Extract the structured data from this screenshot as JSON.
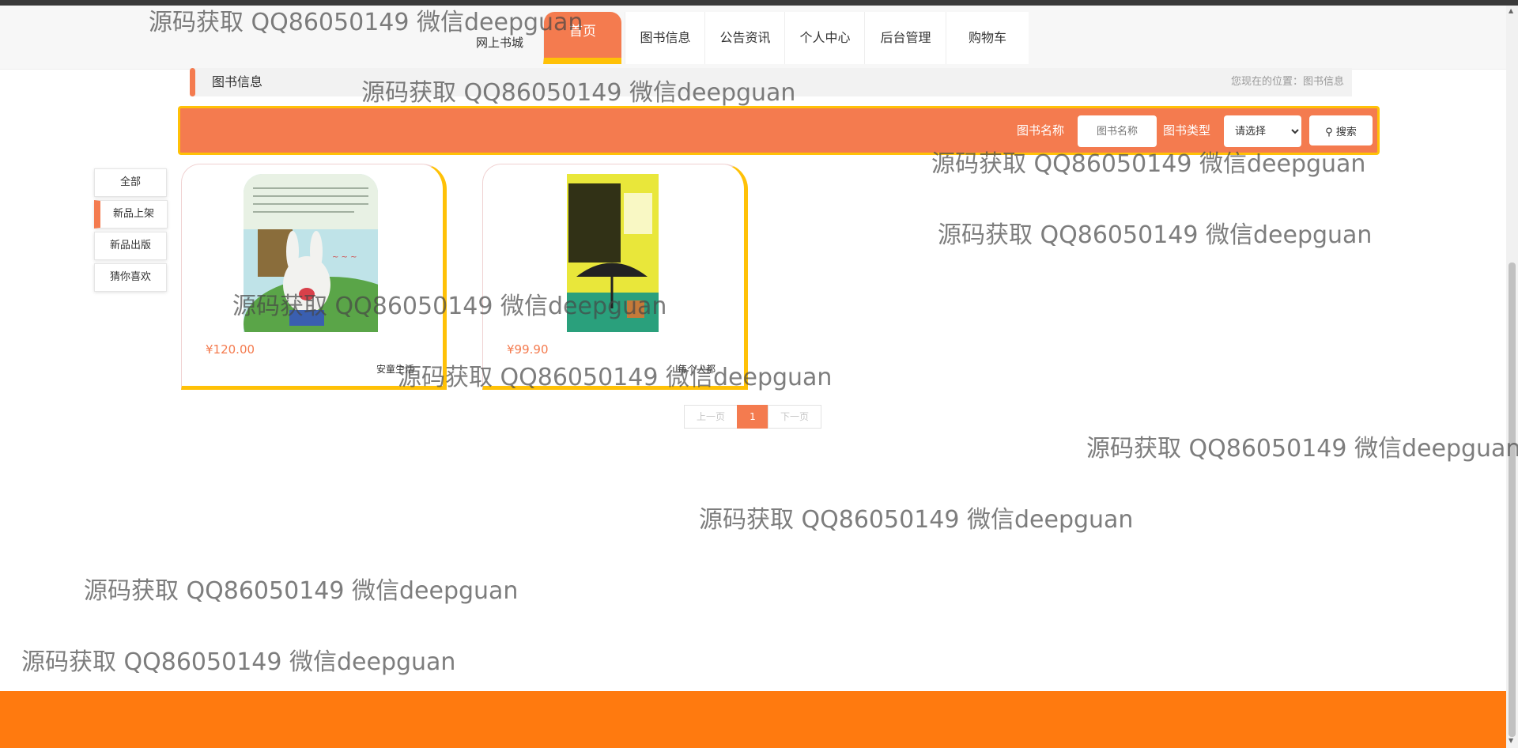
{
  "navbar": {
    "brand": "网上书城",
    "items": [
      {
        "label": "首页"
      },
      {
        "label": "图书信息"
      },
      {
        "label": "公告资讯"
      },
      {
        "label": "个人中心"
      },
      {
        "label": "后台管理"
      },
      {
        "label": "购物车"
      }
    ]
  },
  "section": {
    "title": "图书信息",
    "breadcrumb": "您现在的位置：图书信息"
  },
  "search": {
    "name_label": "图书名称",
    "name_placeholder": "图书名称",
    "type_label": "图书类型",
    "type_selected": "请选择",
    "button_label": "搜索"
  },
  "side_menu": {
    "items": [
      {
        "label": "全部"
      },
      {
        "label": "新品上架"
      },
      {
        "label": "新品出版"
      },
      {
        "label": "猜你喜欢"
      }
    ]
  },
  "books": [
    {
      "price": "¥120.00",
      "name": "安童生活"
    },
    {
      "price": "¥99.90",
      "name": "每个人都"
    }
  ],
  "pagination": {
    "prev": "上一页",
    "current": "1",
    "next": "下一页"
  },
  "watermark": "源码获取 QQ86050149 微信deepguan"
}
